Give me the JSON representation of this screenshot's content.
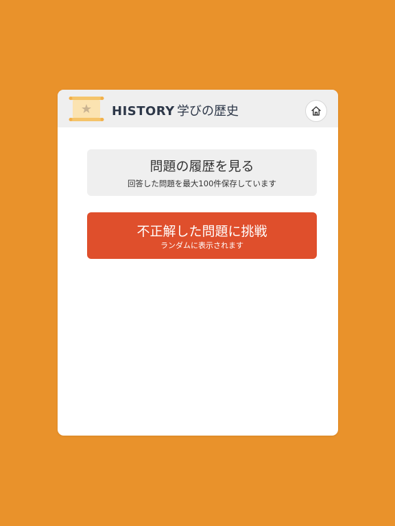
{
  "header": {
    "title_en": "HISTORY",
    "title_ja": "学びの歴史",
    "logo_icon": "scroll-icon",
    "home_icon": "home-icon"
  },
  "menu": {
    "history": {
      "label": "問題の履歴を見る",
      "sublabel": "回答した問題を最大100件保存しています"
    },
    "retry": {
      "label": "不正解した問題に挑戦",
      "sublabel": "ランダムに表示されます"
    }
  },
  "colors": {
    "background": "#e9922b",
    "retry_button": "#df4f2c",
    "history_button": "#efefef",
    "header": "#efefef"
  }
}
